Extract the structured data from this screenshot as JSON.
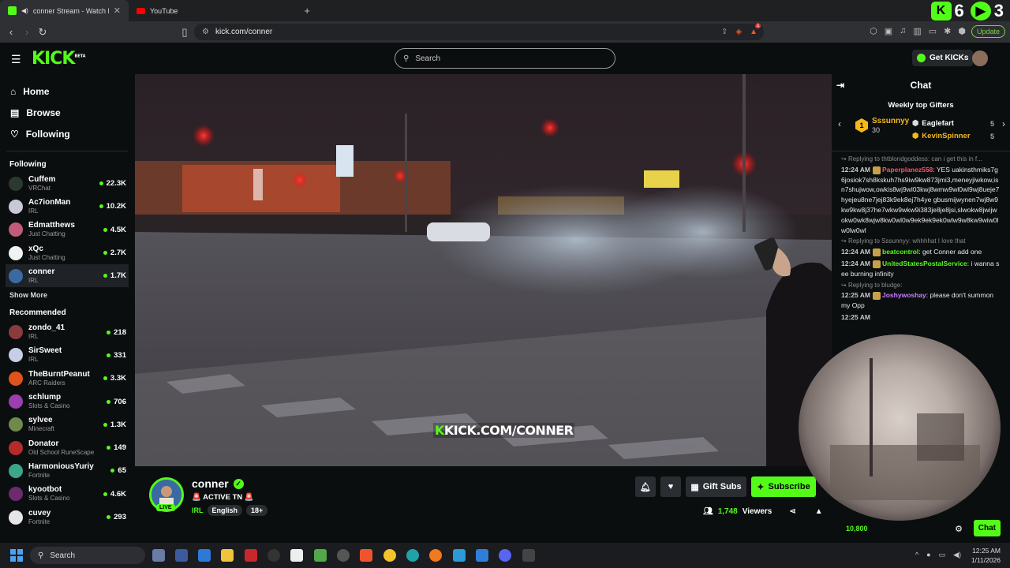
{
  "browser": {
    "tabs": [
      {
        "label": "conner Stream - Watch Live o",
        "active": true
      },
      {
        "label": "YouTube",
        "active": false
      }
    ],
    "url": "kick.com/conner",
    "update_label": "Update",
    "corner_counts": [
      "6",
      "3"
    ],
    "notif_count": "1"
  },
  "kick": {
    "search_placeholder": "Search",
    "get_kicks": "Get KICKs",
    "logo": "KICK",
    "logo_beta": "BETA"
  },
  "sidebar": {
    "nav": [
      {
        "label": "Home",
        "icon": "home-icon"
      },
      {
        "label": "Browse",
        "icon": "browse-icon"
      },
      {
        "label": "Following",
        "icon": "heart-icon"
      }
    ],
    "following_title": "Following",
    "following": [
      {
        "name": "Cuffem",
        "category": "VRChat",
        "viewers": "22.3K",
        "color": "#2b3a2f"
      },
      {
        "name": "Ac7ionMan",
        "category": "IRL",
        "viewers": "10.2K",
        "color": "#c9c9d6"
      },
      {
        "name": "Edmatthews",
        "category": "Just Chatting",
        "viewers": "4.5K",
        "color": "#c25b7a"
      },
      {
        "name": "xQc",
        "category": "Just Chatting",
        "viewers": "2.7K",
        "color": "#f2f2f2"
      },
      {
        "name": "conner",
        "category": "IRL",
        "viewers": "1.7K",
        "color": "#3b6aa3"
      }
    ],
    "show_more": "Show More",
    "recommended_title": "Recommended",
    "recommended": [
      {
        "name": "zondo_41",
        "category": "IRL",
        "viewers": "218",
        "color": "#8a3b3b"
      },
      {
        "name": "SirSweet",
        "category": "IRL",
        "viewers": "331",
        "color": "#c8cde8"
      },
      {
        "name": "TheBurntPeanut",
        "category": "ARC Raiders",
        "viewers": "3.3K",
        "color": "#e0521b"
      },
      {
        "name": "schlump",
        "category": "Slots & Casino",
        "viewers": "706",
        "color": "#9b3fb0"
      },
      {
        "name": "sylvee",
        "category": "Minecraft",
        "viewers": "1.3K",
        "color": "#6f8a4a"
      },
      {
        "name": "Donator",
        "category": "Old School RuneScape",
        "viewers": "149",
        "color": "#b52a2a"
      },
      {
        "name": "HarmoniousYuriy",
        "category": "Fortnite",
        "viewers": "65",
        "color": "#3aa68a"
      },
      {
        "name": "kyootbot",
        "category": "Slots & Casino",
        "viewers": "4.6K",
        "color": "#6e2a6e"
      },
      {
        "name": "cuvey",
        "category": "Fortnite",
        "viewers": "293",
        "color": "#e6e6e6"
      }
    ]
  },
  "player": {
    "watermark_prefix": "K",
    "watermark": "KICK.COM/CONNER"
  },
  "stream": {
    "streamer": "conner",
    "live_label": "LIVE",
    "title": "🚨 ACTIVE TN 🚨",
    "category": "IRL",
    "tags": [
      "English",
      "18+"
    ],
    "gift_subs": "Gift Subs",
    "subscribe": "Subscribe",
    "viewers": "1,748",
    "viewers_label": "Viewers"
  },
  "chat": {
    "title": "Chat",
    "gifters_title": "Weekly top Gifters",
    "top_gifter": {
      "rank": "1",
      "name": "Sssunnyy",
      "count": "30"
    },
    "gifters": [
      {
        "name": "Eaglefart",
        "count": "5",
        "color": "#ffffff"
      },
      {
        "name": "KevinSpinner",
        "count": "5",
        "color": "#f5b818"
      }
    ],
    "messages": [
      {
        "reply": "Replying to thtblondgoddess: can i get this in f...",
        "time": "12:24 AM",
        "user": "Paperplanez558",
        "user_color": "#ff4f6a",
        "text": "YES uakinsthmiks7g6josiok7sh8kskuh7hs9iw9kw873jmi3,meneyjiwkow,isn7shujwow,owkis8wj9wl03kwj8wmw9wl0wl9wj8ueje7hyejeu8ne7jej83k9ek8ej7h4ye gbusmijwynen7wj8w9kw9kw8j37he7wkw9wkw9i383je8je8jsi,slwokw8jwijwokw0wk8wjw8kw0wl0w9ek9ek9ek0wlw9w8kw9wiw0lw0lw0wl"
      },
      {
        "reply": "Replying to Sssunnyy: whhhhat I love that",
        "time": "12:24 AM",
        "user": "beatcontrol",
        "user_color": "#53fc18",
        "text": "get Conner add one"
      },
      {
        "reply": "",
        "time": "12:24 AM",
        "user": "UnitedStatesPostalService",
        "user_color": "#53fc18",
        "text": "i wanna see burning infinity"
      },
      {
        "reply": "Replying to bludge:",
        "time": "12:25 AM",
        "user": "Joshywoshay",
        "user_color": "#c77dff",
        "text": "please don't summon my Opp"
      },
      {
        "reply": "",
        "time": "12:25 AM",
        "user": "",
        "user_color": "#a0a0a0",
        "text": ""
      }
    ],
    "points": "10,800",
    "send_label": "Chat"
  },
  "taskbar": {
    "search_placeholder": "Search",
    "time": "12:25 AM",
    "date": "1/11/2026"
  }
}
